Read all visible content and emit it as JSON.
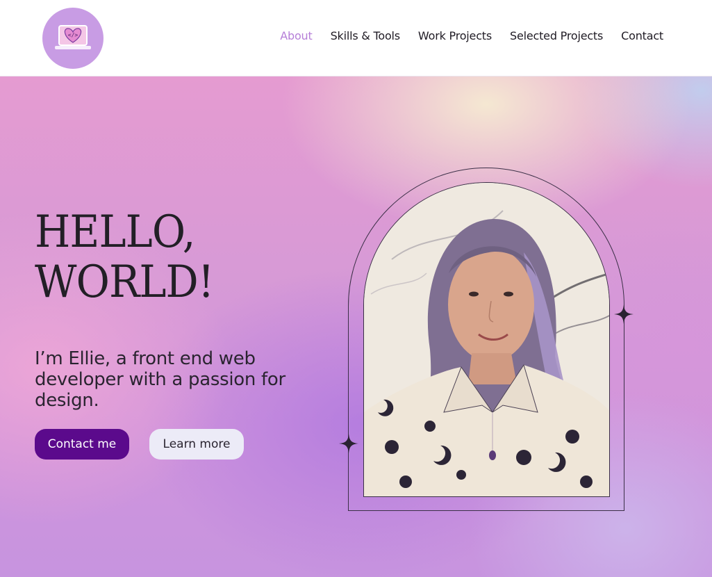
{
  "header": {
    "logo_icon": "laptop-heart-code-icon",
    "nav": [
      {
        "label": "About",
        "active": true
      },
      {
        "label": "Skills & Tools",
        "active": false
      },
      {
        "label": "Work Projects",
        "active": false
      },
      {
        "label": "Selected Projects",
        "active": false
      },
      {
        "label": "Contact",
        "active": false
      }
    ]
  },
  "hero": {
    "heading_line1": "HELLO,",
    "heading_line2": "WORLD!",
    "intro": "I’m Ellie, a front end web developer with a passion for design.",
    "contact_button": "Contact me",
    "learn_button": "Learn more",
    "portrait_icon": "portrait-photo",
    "sparkle_icon": "four-point-star-icon"
  },
  "colors": {
    "accent": "#b67fd8",
    "primary_button": "#5b0a8c",
    "secondary_button": "#ecebf7",
    "text_dark": "#221f26"
  }
}
